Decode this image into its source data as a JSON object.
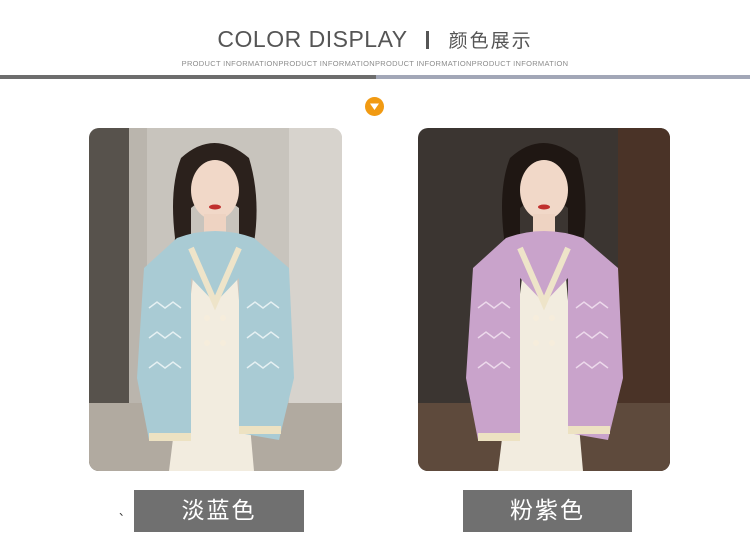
{
  "header": {
    "title_en": "COLOR DISPLAY",
    "separator": "I",
    "title_cn": "颜色展示",
    "subtitle": "PRODUCT INFORMATIONPRODUCT INFORMATIONPRODUCT INFORMATIONPRODUCT INFORMATION"
  },
  "colors": {
    "rule_left": "#6d6d6d",
    "rule_right": "#a2a7b7",
    "badge": "#f19a12",
    "label_bg": "#707070"
  },
  "products": [
    {
      "photo_icon": "model-photo-light-blue",
      "label": "淡蓝色"
    },
    {
      "photo_icon": "model-photo-pink-purple",
      "label": "粉紫色"
    }
  ],
  "stray_mark": "、"
}
